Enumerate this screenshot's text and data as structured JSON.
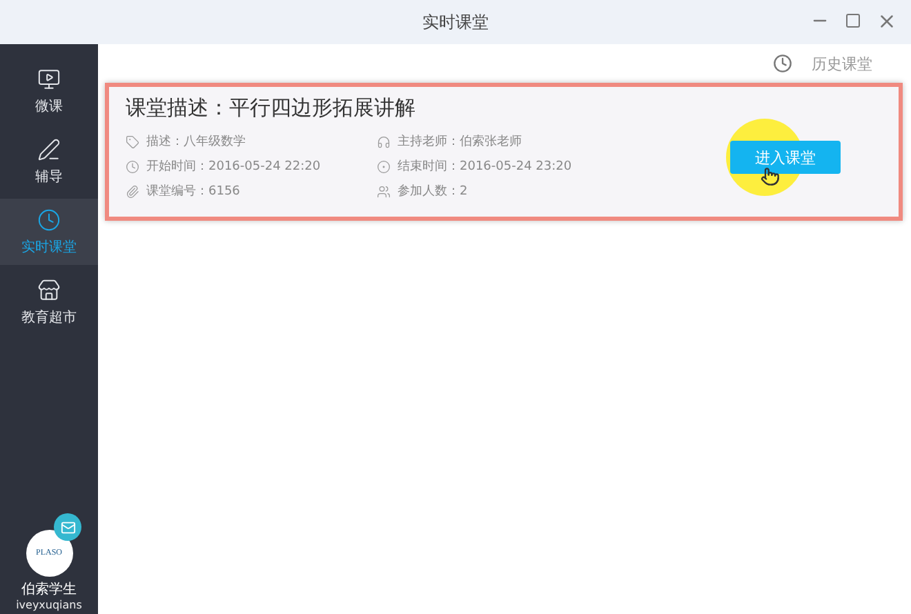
{
  "window": {
    "title": "实时课堂"
  },
  "sidebar": {
    "items": [
      {
        "label": "微课",
        "selected": false
      },
      {
        "label": "辅导",
        "selected": false
      },
      {
        "label": "实时课堂",
        "selected": true
      },
      {
        "label": "教育超市",
        "selected": false
      }
    ],
    "user": {
      "logo": "PLASO",
      "name": "伯索学生",
      "username": "iveyxuqians",
      "has_message": true
    }
  },
  "header": {
    "history_link": "历史课堂"
  },
  "classes": [
    {
      "title": "课堂描述：平行四边形拓展讲解",
      "fields": [
        "描述：八年级数学",
        "主持老师：伯索张老师",
        "开始时间：2016-05-24 22:20",
        "结束时间：2016-05-24 23:20",
        "课堂编号：6156",
        "参加人数：2"
      ],
      "button": "进入课堂",
      "highlighted": true,
      "hovered": true
    }
  ]
}
